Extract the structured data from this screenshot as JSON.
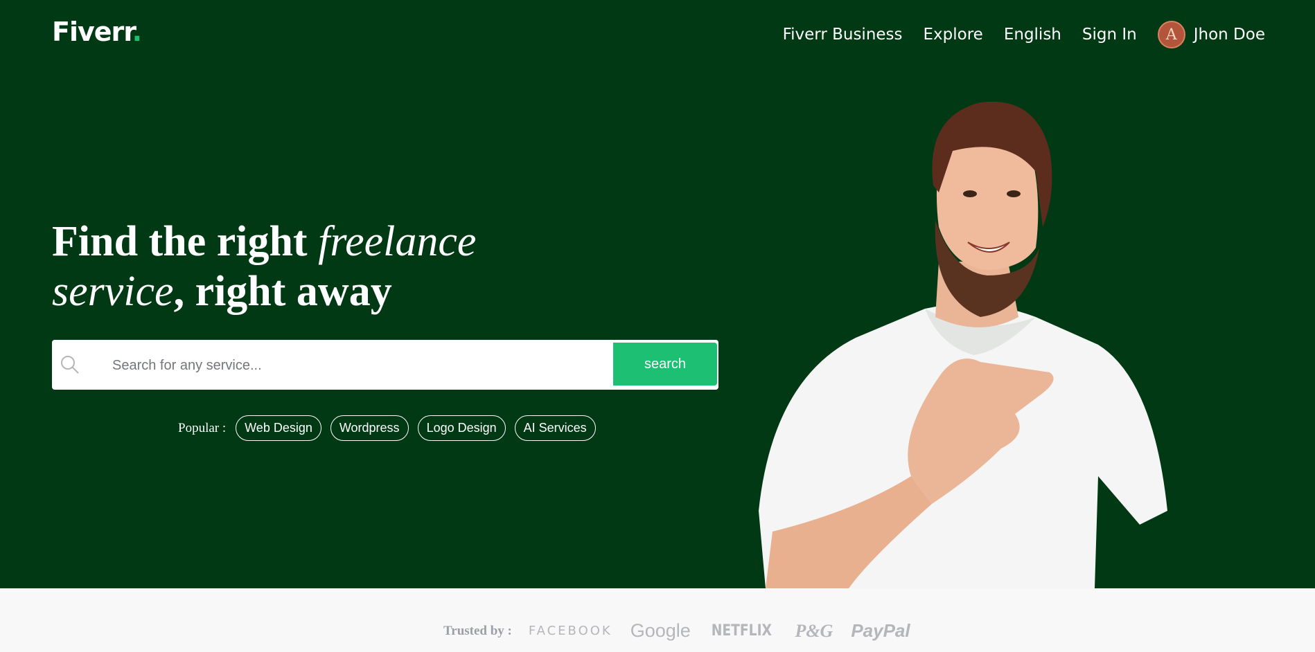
{
  "brand": {
    "logo_text": "Fiverr",
    "logo_dot": ".",
    "accent_color": "#1dbf73",
    "hero_bg": "#013914"
  },
  "nav": {
    "links": [
      "Fiverr Business",
      "Explore",
      "English",
      "Sign In"
    ],
    "user": {
      "name": "Jhon Doe",
      "avatar_icon": "avatar-icon"
    }
  },
  "hero": {
    "headline_part1": "Find the right ",
    "headline_italic1": "freelance",
    "headline_italic2": "service",
    "headline_part2": ", right away",
    "search": {
      "placeholder": "Search for any service...",
      "button_label": "search",
      "icon": "search-icon"
    },
    "popular": {
      "label": "Popular :",
      "tags": [
        "Web Design",
        "Wordpress",
        "Logo Design",
        "AI Services"
      ]
    },
    "image": "smiling-bearded-man-in-white-tshirt"
  },
  "trusted": {
    "label": "Trusted by :",
    "brands": [
      "FACEBOOK",
      "Google",
      "NETFLIX",
      "P&G",
      "PayPal"
    ]
  }
}
